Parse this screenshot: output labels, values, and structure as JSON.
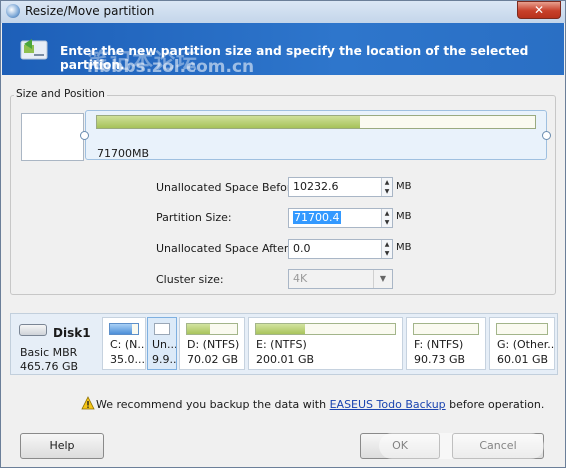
{
  "window": {
    "title": "Resize/Move partition",
    "close_label": "✕"
  },
  "banner": {
    "text": "Enter the new partition size and specify the location of the selected partition.",
    "watermark_cn": "笔记本论坛",
    "watermark_url": "nbbbs.zol.com.cn"
  },
  "size_position": {
    "group_label": "Size and Position",
    "bar_label": "71700MB",
    "fill_fraction": 0.6
  },
  "form": {
    "unalloc_before_label": "Unallocated Space Before:",
    "unalloc_before_value": "10232.6",
    "partition_size_label": "Partition Size:",
    "partition_size_value": "71700.4",
    "unalloc_after_label": "Unallocated Space After:",
    "unalloc_after_value": "0.0",
    "cluster_size_label": "Cluster size:",
    "cluster_size_value": "4K",
    "unit": "MB"
  },
  "disk": {
    "name": "Disk1",
    "type": "Basic MBR",
    "size": "465.76 GB",
    "partitions": [
      {
        "label": "C: (N...",
        "size": "35.0...",
        "fill": 0.8,
        "style": "blue"
      },
      {
        "label": "Un...",
        "size": "9.9...",
        "fill": 0.0,
        "style": "white"
      },
      {
        "label": "D: (NTFS)",
        "size": "70.02 GB",
        "fill": 0.45,
        "style": "green"
      },
      {
        "label": "E: (NTFS)",
        "size": "200.01 GB",
        "fill": 0.35,
        "style": "green"
      },
      {
        "label": "F: (NTFS)",
        "size": "90.73 GB",
        "fill": 0.0,
        "style": "green"
      },
      {
        "label": "G: (Other...",
        "size": "60.01 GB",
        "fill": 0.0,
        "style": "green"
      }
    ]
  },
  "warning": {
    "before": "We recommend you backup the data with ",
    "link": "EASEUS Todo Backup",
    "after": " before operation."
  },
  "buttons": {
    "help": "Help",
    "ok": "OK",
    "cancel": "Cancel"
  }
}
